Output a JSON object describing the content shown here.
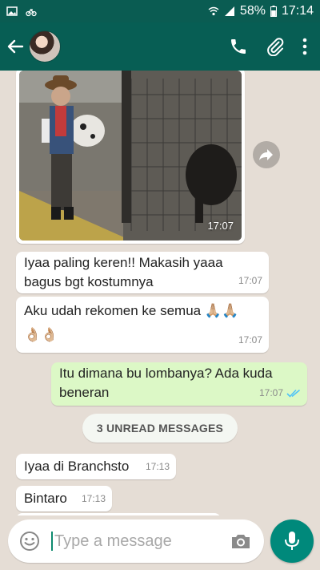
{
  "status_bar": {
    "battery": "58%",
    "time": "17:14"
  },
  "header": {
    "back_icon": "arrow-left-icon",
    "avatar_alt": "contact avatar",
    "actions": [
      "phone-icon",
      "paperclip-icon",
      "more-vert-icon"
    ]
  },
  "messages": [
    {
      "type": "image",
      "direction": "incoming",
      "time": "17:07"
    },
    {
      "type": "text",
      "direction": "incoming",
      "line1": "Iyaa paling keren!! Makasih yaaa",
      "line2": "bagus bgt kostumnya",
      "time": "17:07"
    },
    {
      "type": "text",
      "direction": "incoming",
      "line1": "Aku udah rekomen ke semua",
      "emoji1": "🙏🏼🙏🏼",
      "emoji2": "👌🏼👌🏼",
      "time": "17:07"
    },
    {
      "type": "text",
      "direction": "outgoing",
      "line1": "Itu dimana bu lombanya? Ada kuda",
      "line2": "beneran",
      "time": "17:07",
      "status": "read"
    },
    {
      "type": "text",
      "direction": "incoming",
      "line1": "Iyaa di Branchsto",
      "time": "17:13"
    },
    {
      "type": "text",
      "direction": "incoming",
      "line1": "Bintaro",
      "time": "17:13"
    }
  ],
  "unread_label": "3 UNREAD MESSAGES",
  "composer": {
    "placeholder": "Type a message",
    "value": ""
  },
  "colors": {
    "header": "#075e54",
    "status_bar": "#0a5c52",
    "chat_bg": "#e5ddd5",
    "outgoing_bubble": "#dcf8c6",
    "incoming_bubble": "#ffffff",
    "mic_button": "#00897b",
    "read_ticks": "#4fc3f7"
  }
}
